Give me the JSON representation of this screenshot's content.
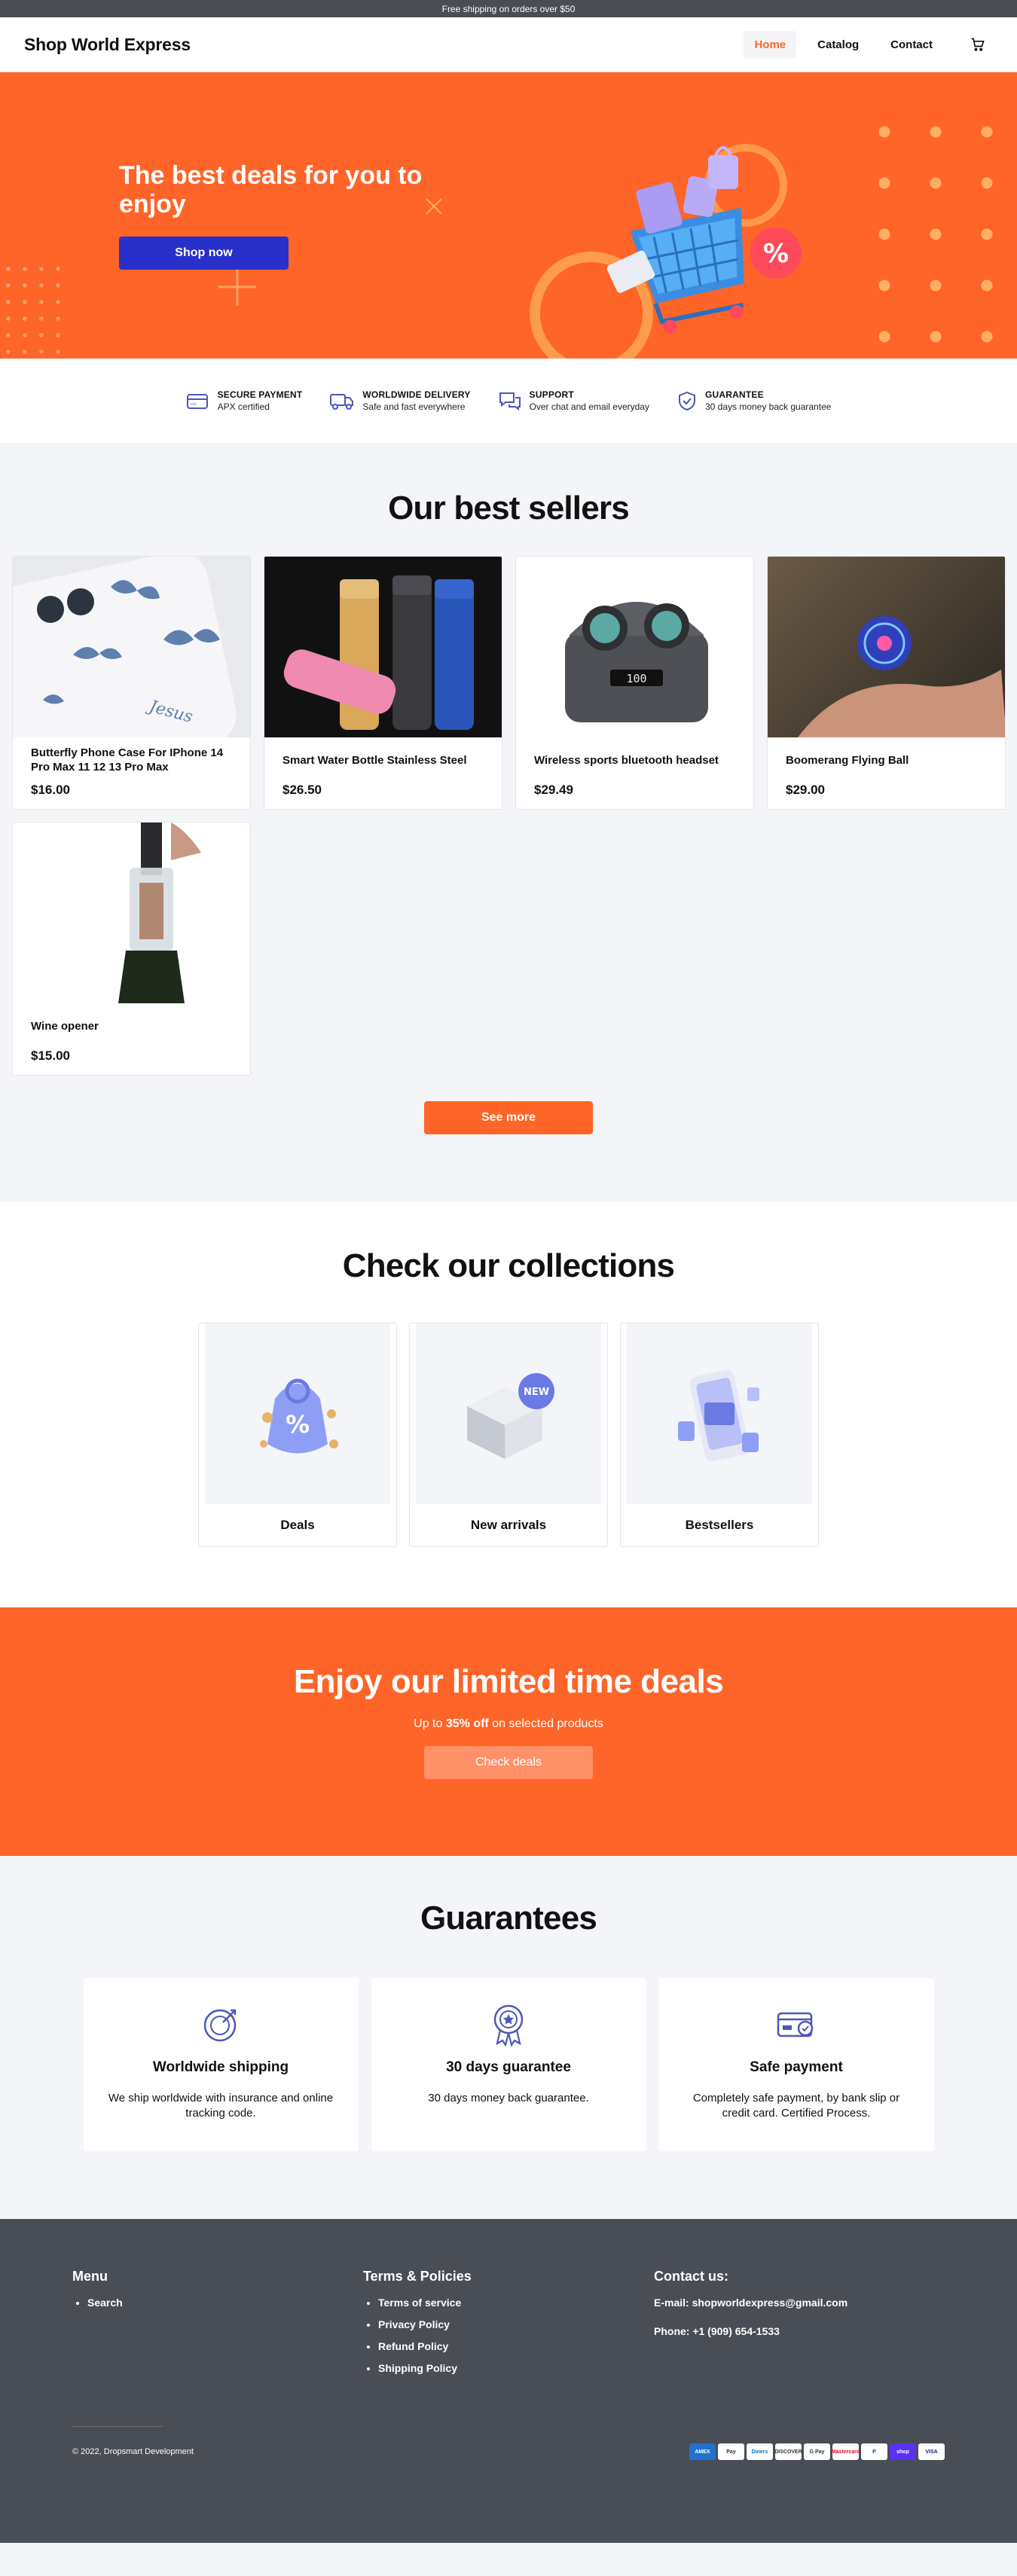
{
  "announcement": "Free shipping on orders over $50",
  "header": {
    "brand": "Shop World Express",
    "nav": [
      "Home",
      "Catalog",
      "Contact"
    ]
  },
  "hero": {
    "title": "The best deals for you to enjoy",
    "button": "Shop now"
  },
  "features": [
    {
      "title": "SECURE PAYMENT",
      "sub": "APX certified",
      "icon": "credit-card-icon"
    },
    {
      "title": "WORLDWIDE DELIVERY",
      "sub": "Safe and fast everywhere",
      "icon": "truck-icon"
    },
    {
      "title": "SUPPORT",
      "sub": "Over chat and email everyday",
      "icon": "chat-icon"
    },
    {
      "title": "GUARANTEE",
      "sub": "30 days money back guarantee",
      "icon": "shield-icon"
    }
  ],
  "bestsellers": {
    "title": "Our best sellers",
    "products": [
      {
        "name": "Butterfly Phone Case For IPhone 14 Pro Max 11 12 13 Pro Max",
        "price": "$16.00"
      },
      {
        "name": "Smart Water Bottle Stainless Steel",
        "price": "$26.50"
      },
      {
        "name": "Wireless sports bluetooth headset",
        "price": "$29.49"
      },
      {
        "name": "Boomerang Flying Ball",
        "price": "$29.00"
      },
      {
        "name": "Wine opener",
        "price": "$15.00"
      }
    ],
    "see_more": "See more"
  },
  "collections": {
    "title": "Check our collections",
    "items": [
      "Deals",
      "New arrivals",
      "Bestsellers"
    ],
    "badge": "NEW"
  },
  "promo": {
    "title": "Enjoy our limited time deals",
    "text_before": "Up to ",
    "text_bold": "35% off",
    "text_after": " on selected products",
    "button": "Check deals"
  },
  "guarantees": {
    "title": "Guarantees",
    "items": [
      {
        "title": "Worldwide shipping",
        "desc": "We ship worldwide with insurance and online tracking code."
      },
      {
        "title": "30 days guarantee",
        "desc": "30 days money back guarantee."
      },
      {
        "title": "Safe payment",
        "desc": "Completely safe payment, by bank slip or credit card. Certified Process."
      }
    ]
  },
  "footer": {
    "menu_title": "Menu",
    "menu_items": [
      "Search"
    ],
    "terms_title": "Terms & Policies",
    "terms_items": [
      "Terms of service",
      "Privacy Policy",
      "Refund Policy",
      "Shipping Policy"
    ],
    "contact_title": "Contact us:",
    "email": "E-mail: shopworldexpress@gmail.com",
    "phone": "Phone: +1 (909) 654-1533",
    "copyright": "© 2022, Dropsmart Development",
    "payments": [
      "AMEX",
      "Pay",
      "Diners",
      "DISCOVER",
      "G Pay",
      "Mastercard",
      "P",
      "shop",
      "VISA"
    ]
  },
  "colors": {
    "accent": "#ff6428",
    "button_blue": "#2930c9",
    "footer_bg": "#494d56"
  }
}
